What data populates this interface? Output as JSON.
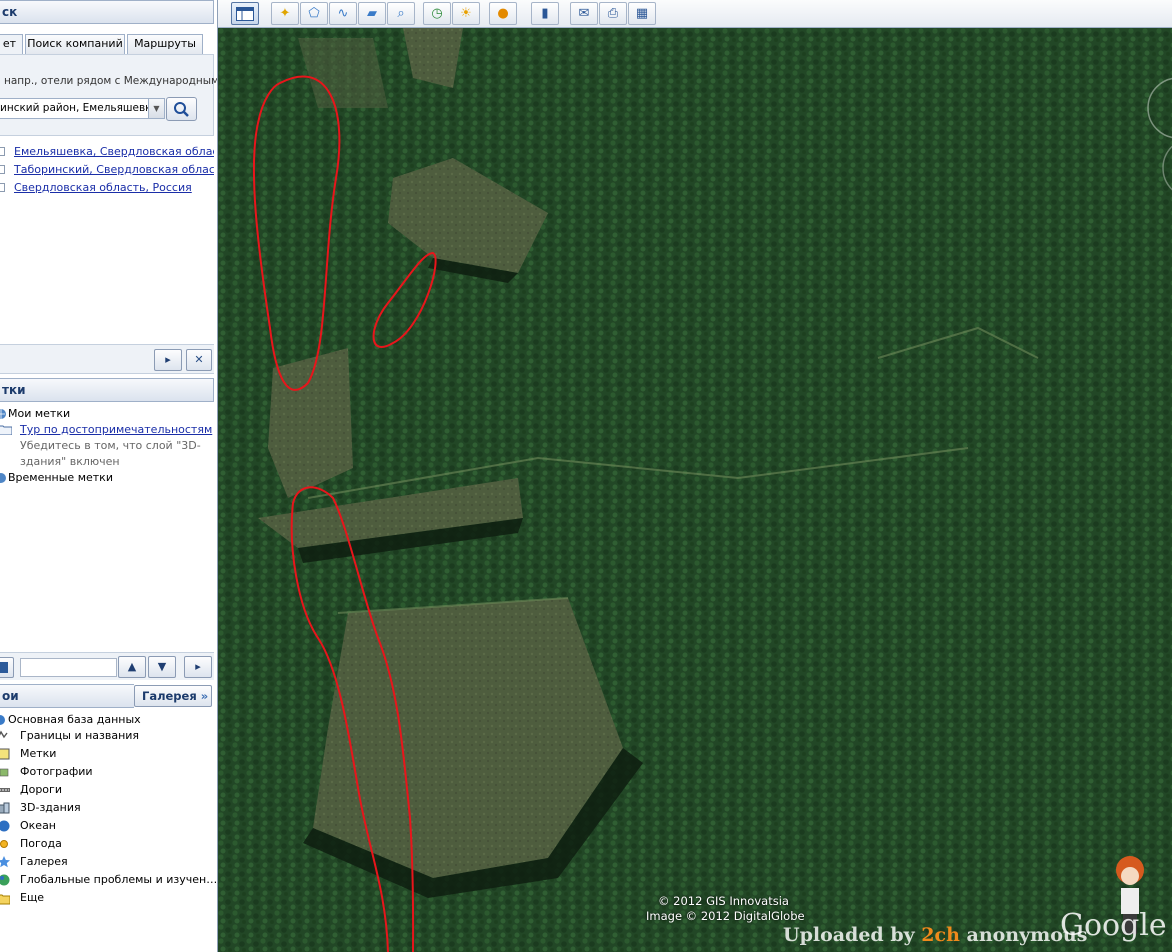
{
  "search_panel": {
    "header": "ск",
    "tabs": [
      "ет",
      "Поиск компаний",
      "Маршруты"
    ],
    "hint": "напр., отели рядом с Международным",
    "combo_value": "инский район, Емельяшевка",
    "results": [
      "Емельяшевка, Свердловская облас",
      "Таборинский, Свердловская облас",
      "Свердловская область, Россия"
    ]
  },
  "places_panel": {
    "header": "тки",
    "my_places": "Мои метки",
    "tour_link": "Тур по достопримечательностям",
    "tour_note_1": "Убедитесь в том, что слой \"3D-",
    "tour_note_2": "здания\" включен",
    "temp_places": "Временные метки"
  },
  "layers_panel": {
    "header": "ои",
    "gallery_button": "Галерея",
    "items": [
      "Основная база данных",
      "Границы и названия",
      "Метки",
      "Фотографии",
      "Дороги",
      "3D-здания",
      "Океан",
      "Погода",
      "Галерея",
      "Глобальные проблемы и изучен…",
      "Еще"
    ]
  },
  "map": {
    "copyright_1": "© 2012 GIS Innovatsia",
    "copyright_2": "Image © 2012 DigitalGlobe",
    "watermark_pre": "Uploaded by ",
    "watermark_brand": "2ch",
    "watermark_post": " anonymous",
    "logo": "Google e",
    "forest_color": "#234a26",
    "clearing_color": "#4d5c3c",
    "annotation_color": "#e8151b"
  }
}
